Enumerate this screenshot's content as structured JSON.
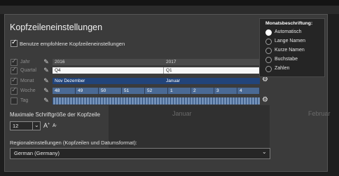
{
  "window": {
    "title": "Kopfzeileneinstellungen"
  },
  "use_recommended": {
    "label": "Benutze empfohlene Kopfzeileneinstellungen",
    "checked": true
  },
  "timeline": {
    "rows": [
      {
        "label": "Jahr",
        "checked": true
      },
      {
        "label": "Quartal",
        "checked": true
      },
      {
        "label": "Monat",
        "checked": true
      },
      {
        "label": "Woche",
        "checked": true
      },
      {
        "label": "Tag",
        "checked": false
      }
    ],
    "years": [
      "2016",
      "2017"
    ],
    "quarters": [
      "Q4",
      "Q1"
    ],
    "months": [
      "Nov Dezember",
      "Januar"
    ],
    "weeks": [
      "48",
      "49",
      "50",
      "51",
      "52",
      "1",
      "2",
      "3",
      "4"
    ]
  },
  "font_size": {
    "label": "Maximale Schriftgröße der Kopfzeile",
    "value": "12",
    "increase": "A",
    "decrease": "A"
  },
  "regional": {
    "label": "Regionaleinstellungen (Kopfzeilen und Datumsformat):",
    "value": "German (Germany)"
  },
  "background_months": [
    "Januar",
    "Februar"
  ],
  "month_labels_popup": {
    "title": "Monatsbeschriftung:",
    "options": [
      "Automatisch",
      "Lange Namen",
      "Kurze Namen",
      "Buchstabe",
      "Zahlen"
    ],
    "selected": "Automatisch"
  },
  "icons": {
    "edit": "pencil-icon",
    "settings": "gear-icon",
    "dropdown": "chevron-down-icon"
  },
  "colors": {
    "month_row": "#22447a",
    "week_row": "#4a6a95",
    "panel": "#3b3b3b",
    "popup": "#252525"
  }
}
